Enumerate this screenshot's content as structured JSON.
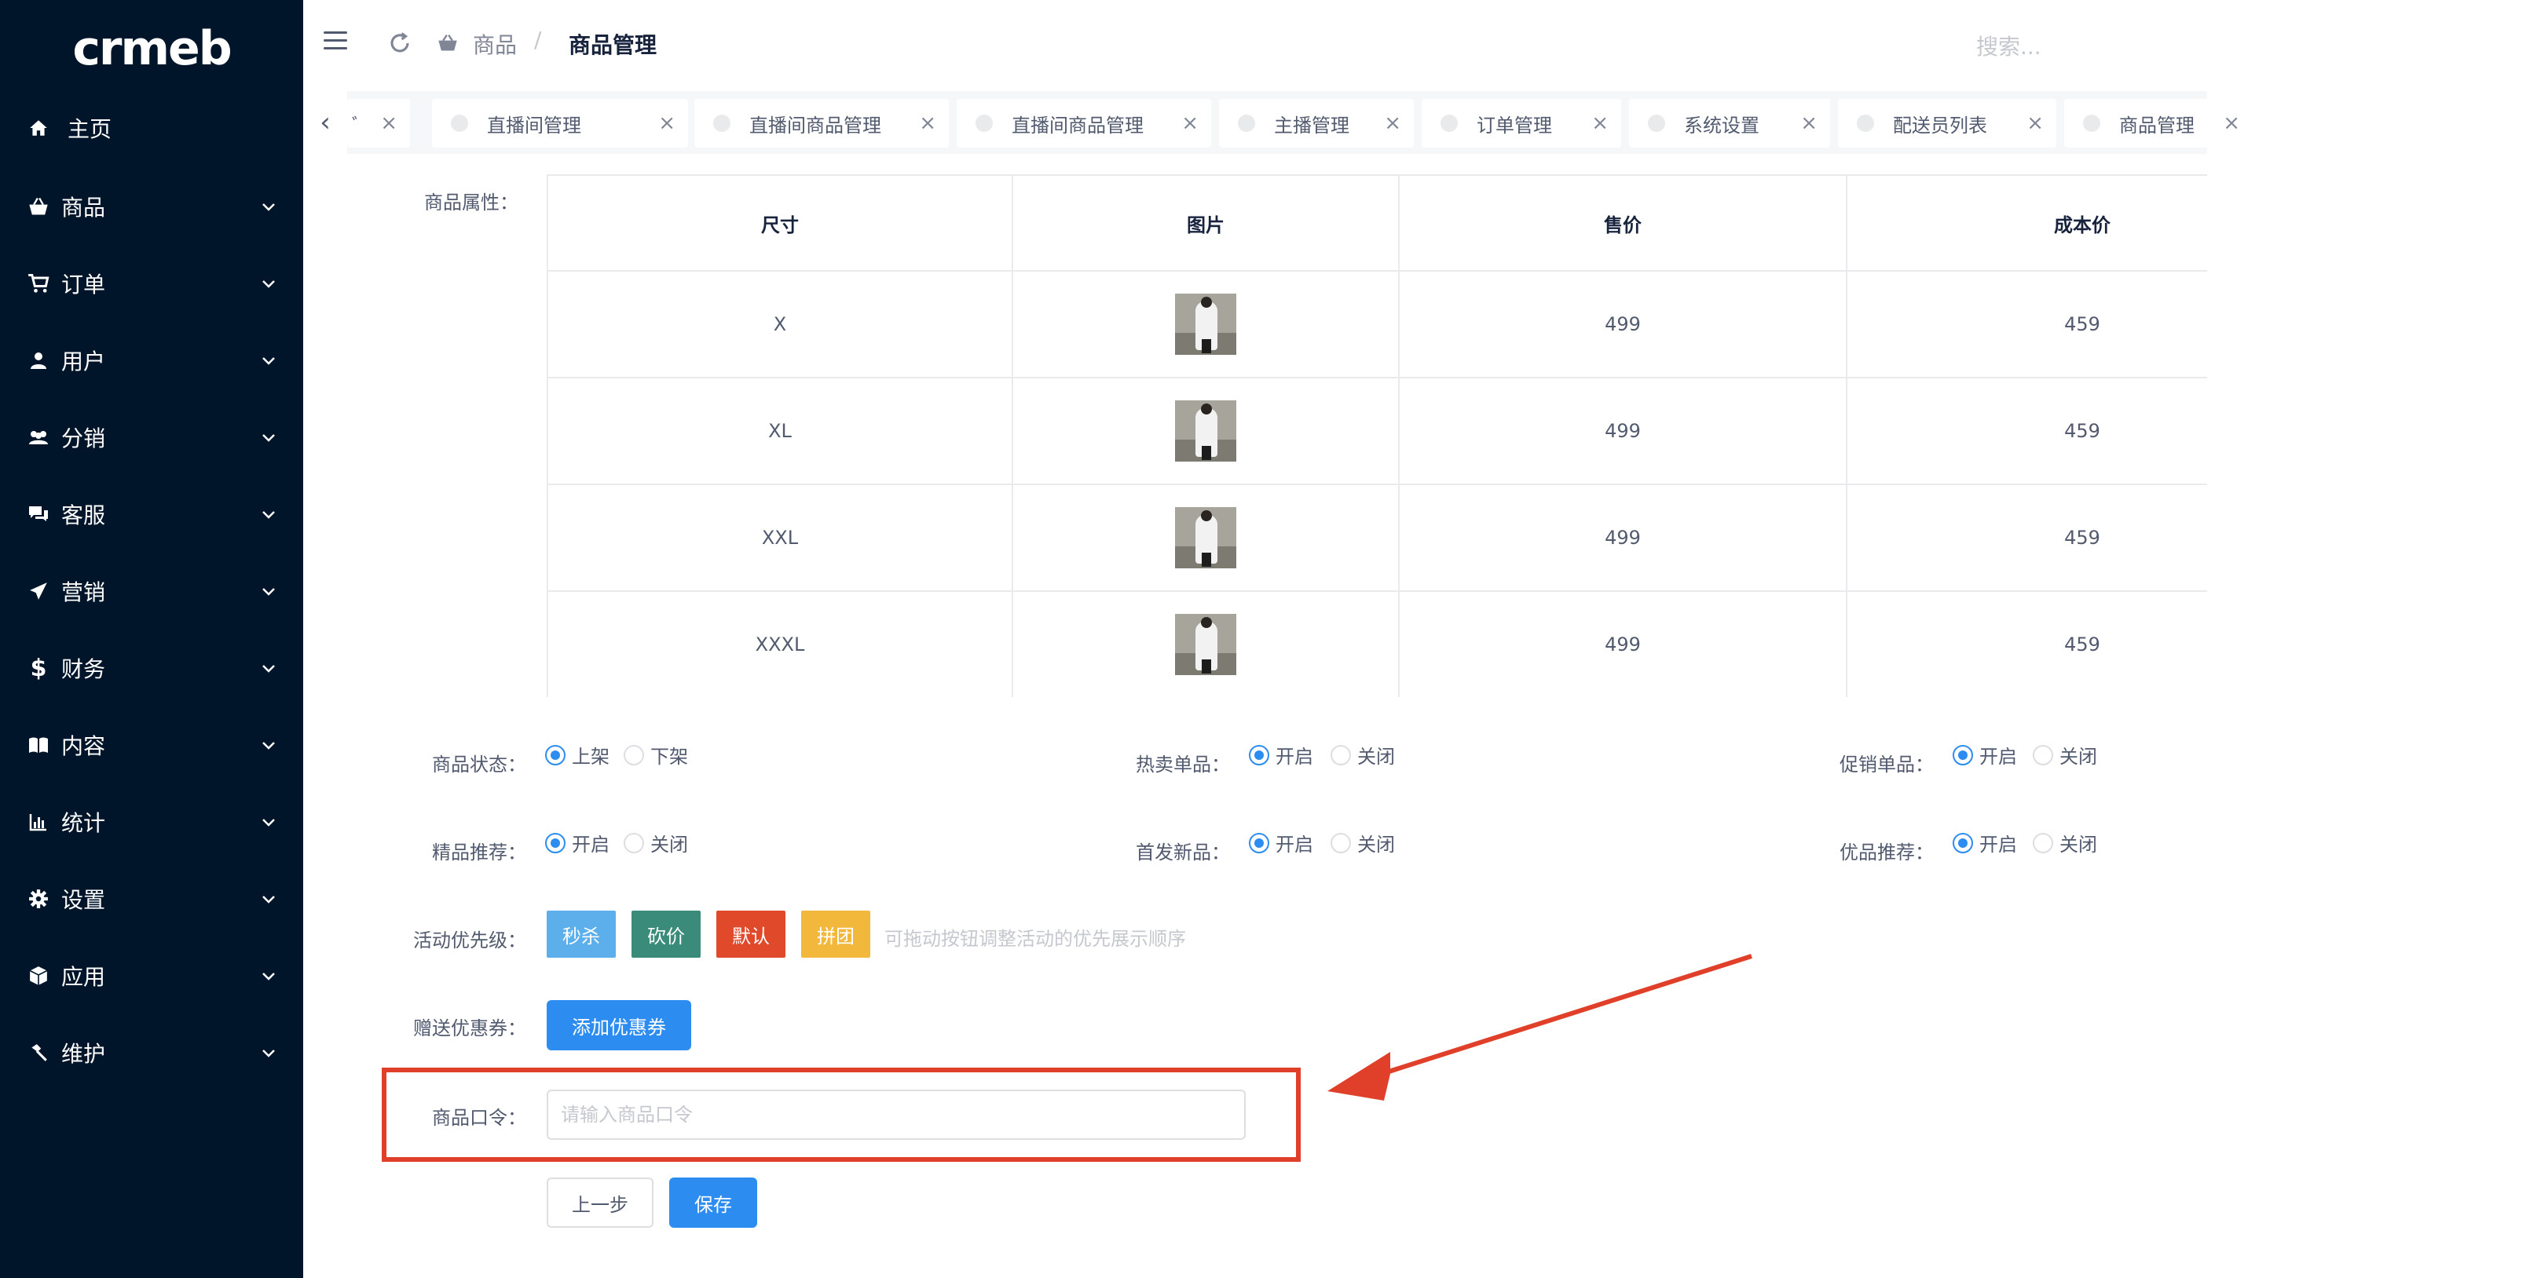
{
  "sidebar": {
    "logo": "crmeb",
    "items": [
      {
        "label": "主页",
        "icon": "home-icon"
      },
      {
        "label": "商品",
        "icon": "basket-icon"
      },
      {
        "label": "订单",
        "icon": "cart-icon"
      },
      {
        "label": "用户",
        "icon": "user-icon"
      },
      {
        "label": "分销",
        "icon": "group-icon"
      },
      {
        "label": "客服",
        "icon": "chat-icon"
      },
      {
        "label": "营销",
        "icon": "send-icon"
      },
      {
        "label": "财务",
        "icon": "dollar-icon"
      },
      {
        "label": "内容",
        "icon": "book-icon"
      },
      {
        "label": "统计",
        "icon": "bar-chart-icon"
      },
      {
        "label": "设置",
        "icon": "gear-icon"
      },
      {
        "label": "应用",
        "icon": "cube-icon"
      },
      {
        "label": "维护",
        "icon": "hammer-icon"
      }
    ]
  },
  "header": {
    "breadcrumb": [
      "商品",
      "商品管理"
    ],
    "search_placeholder": "搜索..."
  },
  "tabs": [
    {
      "label": "直播间管理"
    },
    {
      "label": "直播间商品管理"
    },
    {
      "label": "直播间商品管理"
    },
    {
      "label": "主播管理"
    },
    {
      "label": "订单管理"
    },
    {
      "label": "系统设置"
    },
    {
      "label": "配送员列表"
    },
    {
      "label": "商品管理"
    }
  ],
  "form": {
    "attr_label": "商品属性：",
    "table": {
      "headers": [
        "尺寸",
        "图片",
        "售价",
        "成本价"
      ],
      "rows": [
        {
          "size": "X",
          "price": "499",
          "cost": "459"
        },
        {
          "size": "XL",
          "price": "499",
          "cost": "459"
        },
        {
          "size": "XXL",
          "price": "499",
          "cost": "459"
        },
        {
          "size": "XXXL",
          "price": "499",
          "cost": "459"
        }
      ]
    },
    "status": {
      "label": "商品状态：",
      "on": "上架",
      "off": "下架"
    },
    "hot": {
      "label": "热卖单品：",
      "on": "开启",
      "off": "关闭"
    },
    "promo": {
      "label": "促销单品：",
      "on": "开启",
      "off": "关闭"
    },
    "best": {
      "label": "精品推荐：",
      "on": "开启",
      "off": "关闭"
    },
    "new": {
      "label": "首发新品：",
      "on": "开启",
      "off": "关闭"
    },
    "good": {
      "label": "优品推荐：",
      "on": "开启",
      "off": "关闭"
    },
    "priority": {
      "label": "活动优先级：",
      "tags": [
        {
          "label": "秒杀",
          "color": "#5dafec"
        },
        {
          "label": "砍价",
          "color": "#3b8b7a"
        },
        {
          "label": "默认",
          "color": "#e0492a"
        },
        {
          "label": "拼团",
          "color": "#f2b83b"
        }
      ],
      "hint": "可拖动按钮调整活动的优先展示顺序"
    },
    "coupon": {
      "label": "赠送优惠券：",
      "button": "添加优惠券"
    },
    "password": {
      "label": "商品口令：",
      "placeholder": "请输入商品口令",
      "value": ""
    },
    "prev_button": "上一步",
    "save_button": "保存"
  },
  "colors": {
    "sidebar_bg": "#001529",
    "primary": "#2d8cf0",
    "annotation": "#e0402a"
  }
}
